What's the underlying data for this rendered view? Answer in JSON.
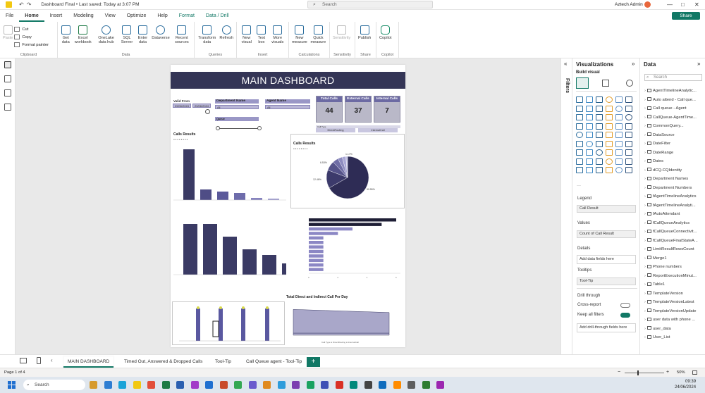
{
  "window": {
    "title": "Dashboard Final • Last saved: Today at 3:07 PM",
    "search_placeholder": "Search",
    "user": "Aztech Admin"
  },
  "ribbon_tabs": [
    "File",
    "Home",
    "Insert",
    "Modeling",
    "View",
    "Optimize",
    "Help",
    "Format",
    "Data / Drill"
  ],
  "share_label": "Share",
  "ribbon": {
    "clipboard": {
      "paste": "Paste",
      "cut": "Cut",
      "copy": "Copy",
      "format_painter": "Format painter",
      "label": "Clipboard"
    },
    "data": {
      "get_data": "Get data",
      "excel": "Excel workbook",
      "onelake": "OneLake data hub",
      "sql": "SQL Server",
      "enter": "Enter data",
      "dataverse": "Dataverse",
      "recent": "Recent sources",
      "label": "Data"
    },
    "queries": {
      "transform": "Transform data",
      "refresh": "Refresh",
      "label": "Queries"
    },
    "insert": {
      "new_visual": "New visual",
      "text_box": "Text box",
      "more_visuals": "More visuals",
      "label": "Insert"
    },
    "calculations": {
      "new_measure": "New measure",
      "quick_measure": "Quick measure",
      "label": "Calculations"
    },
    "sensitivity": {
      "btn": "Sensitivity",
      "label": "Sensitivity"
    },
    "share": {
      "publish": "Publish",
      "label": "Share"
    },
    "copilot": {
      "btn": "Copilot",
      "label": "Copilot"
    }
  },
  "report": {
    "title": "MAIN DASHBOARD",
    "slicers": {
      "valid_from": "Valid From",
      "date_from": "29/06/2024",
      "date_to": "29/06/2024",
      "department_name": "Department Name",
      "department_value": "All",
      "agent_name": "Agent Name",
      "agent_value": "All",
      "queue_label": "Queue"
    },
    "kpis": [
      {
        "label": "Total Calls",
        "value": "44"
      },
      {
        "label": "External Calls",
        "value": "37"
      },
      {
        "label": "Internal Calls",
        "value": "7"
      }
    ],
    "call_type_buttons": [
      "DirectRouting",
      "InternalCall"
    ],
    "call_type_label": "Call Type",
    "calls_results_bar_title": "Calls Results",
    "calls_results_pie_title": "Calls Results",
    "pie_labels": [
      "59.55%",
      "12.46%",
      "6.53%",
      "1.17%"
    ],
    "line_chart_title": "Total Direct and Indirect Call Per Day",
    "line_legend": "Call Type ● DirectRouting ● InternalCall"
  },
  "chart_data": [
    {
      "type": "bar",
      "title": "Calls Results",
      "values": [
        72,
        15,
        12,
        10,
        3,
        2
      ]
    },
    {
      "type": "pie",
      "title": "Calls Results",
      "values": [
        59.55,
        12.46,
        6.53,
        4,
        3,
        2.5,
        1.17
      ]
    },
    {
      "type": "bar",
      "values": [
        36,
        36,
        27,
        18,
        14,
        8
      ]
    },
    {
      "type": "bar",
      "orientation": "horizontal",
      "values": [
        6,
        5,
        3,
        2,
        1,
        1,
        1,
        1,
        1,
        1,
        1,
        1
      ],
      "ticks": [
        0,
        2,
        4,
        6
      ]
    },
    {
      "type": "area",
      "title": "Total Direct and Indirect Call Per Day",
      "series": [
        {
          "name": "DirectRouting",
          "values": [
            25,
            24,
            23,
            22
          ]
        },
        {
          "name": "InternalCall",
          "values": [
            2,
            2,
            2,
            2
          ]
        }
      ]
    }
  ],
  "filters_label": "Filters",
  "viz_pane": {
    "title": "Visualizations",
    "build_visual": "Build visual",
    "legend_label": "Legend",
    "legend_field": "Call Result",
    "values_label": "Values",
    "values_field": "Count of Call Result",
    "details_label": "Details",
    "details_placeholder": "Add data fields here",
    "tooltips_label": "Tooltips",
    "tooltip_field": "Tool-Tip",
    "drill_through_label": "Drill through",
    "cross_report_label": "Cross-report",
    "cross_report_state": "Off",
    "keep_filters_label": "Keep all filters",
    "keep_filters_state": "On",
    "drill_placeholder": "Add drill-through fields here"
  },
  "data_pane": {
    "title": "Data",
    "search_placeholder": "Search",
    "items": [
      "AgentTimelineAnalytic...",
      "Auto attend - Call que...",
      "Call queue - Agent",
      "CallQueue-AgentTime...",
      "CommonQuery...",
      "DataSource",
      "DateFilter",
      "DateRange",
      "Dates",
      "dCQ-CQIdentity",
      "Department Names",
      "Department Numbers",
      "fAgentTimelineAnalytics",
      "fAgentTimelineAnalyti...",
      "fAutoAttendant",
      "fCallQueueAnalytics",
      "fCallQueueConnectivit...",
      "fCallQueueFinalStateA...",
      "LimitResultRowsCount",
      "Merge1",
      "Phone numbers",
      "ReportExecutionMinut...",
      "Table1",
      "TemplateVersion",
      "TemplateVersionLatest",
      "TemplateVersionUpdate",
      "user data with phone ...",
      "user_data",
      "User_List"
    ]
  },
  "page_tabs": [
    "MAIN DASHBOARD",
    "Timed Out, Answered & Dropped Calls",
    "Tool-Tip",
    "Call Queue agent - Tool-Tip"
  ],
  "add_page": "+",
  "status": {
    "page": "Page 1 of 4",
    "zoom": "50%"
  },
  "taskbar": {
    "search": "Search",
    "time": "09:39",
    "date": "24/06/2024"
  },
  "colors": {
    "accent": "#117865",
    "navy": "#343556",
    "bar": "#3a3a64",
    "lavender": "#8b87c4"
  }
}
